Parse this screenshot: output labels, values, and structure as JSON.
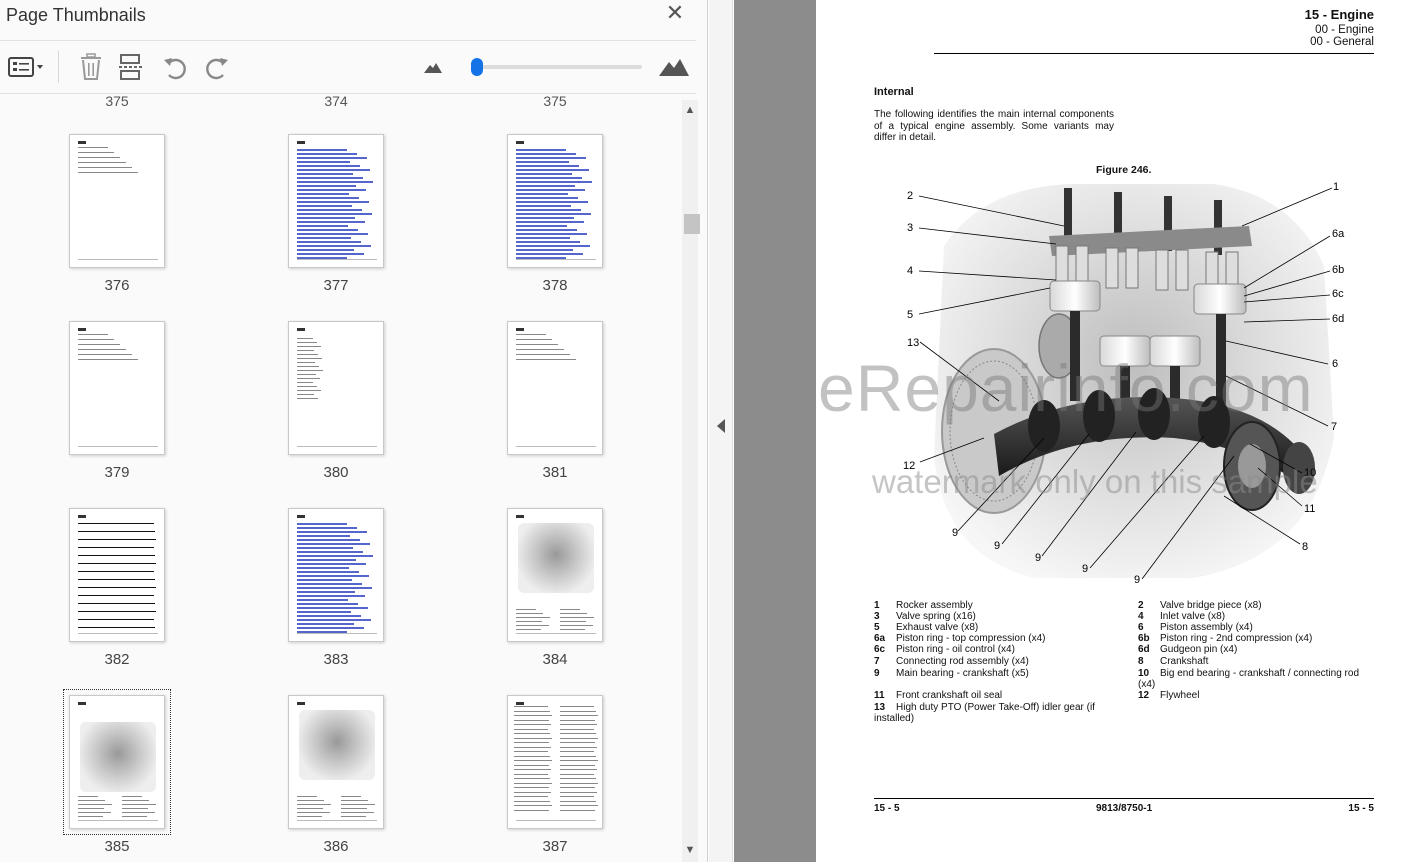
{
  "panel": {
    "title": "Page Thumbnails",
    "close_icon": "close-icon",
    "toolbar": {
      "options_icon": "thumbnail-options-icon",
      "delete_icon": "trash-icon",
      "insert_icon": "insert-pages-icon",
      "rotate_ccw_icon": "rotate-counterclockwise-icon",
      "rotate_cw_icon": "rotate-clockwise-icon",
      "zoom_out_icon": "small-mountain-icon",
      "zoom_in_icon": "large-mountain-icon",
      "zoom_fraction": 0.02
    },
    "cutoff_labels": [
      "375",
      "374",
      "375"
    ],
    "thumbnails": [
      {
        "page": "376"
      },
      {
        "page": "377"
      },
      {
        "page": "378"
      },
      {
        "page": "379"
      },
      {
        "page": "380"
      },
      {
        "page": "381"
      },
      {
        "page": "382"
      },
      {
        "page": "383"
      },
      {
        "page": "384"
      },
      {
        "page": "385",
        "selected": true
      },
      {
        "page": "386"
      },
      {
        "page": "387"
      }
    ]
  },
  "document": {
    "header": {
      "title": "15 - Engine",
      "sub1": "00 - Engine",
      "sub2": "00 - General"
    },
    "section_title": "Internal",
    "intro": "The following identifies the main internal components of a typical engine assembly. Some variants may differ in detail.",
    "figure_title": "Figure 246.",
    "callouts": [
      "1",
      "2",
      "3",
      "4",
      "5",
      "6a",
      "6b",
      "6c",
      "6d",
      "6",
      "7",
      "8",
      "9",
      "9",
      "9",
      "9",
      "9",
      "10",
      "11",
      "12",
      "13"
    ],
    "legend": [
      {
        "num": "1",
        "text": "Rocker assembly"
      },
      {
        "num": "2",
        "text": "Valve bridge piece (x8)"
      },
      {
        "num": "3",
        "text": "Valve spring (x16)"
      },
      {
        "num": "4",
        "text": "Inlet valve (x8)"
      },
      {
        "num": "5",
        "text": "Exhaust valve (x8)"
      },
      {
        "num": "6",
        "text": "Piston assembly (x4)"
      },
      {
        "num": "6a",
        "text": "Piston ring - top compression (x4)"
      },
      {
        "num": "6b",
        "text": "Piston ring - 2nd compression (x4)"
      },
      {
        "num": "6c",
        "text": "Piston ring - oil control (x4)"
      },
      {
        "num": "6d",
        "text": "Gudgeon pin (x4)"
      },
      {
        "num": "7",
        "text": "Connecting rod assembly (x4)"
      },
      {
        "num": "8",
        "text": "Crankshaft"
      },
      {
        "num": "9",
        "text": "Main bearing - crankshaft (x5)"
      },
      {
        "num": "10",
        "text": "Big end bearing - crankshaft / connecting rod (x4)"
      },
      {
        "num": "11",
        "text": "Front crankshaft oil seal"
      },
      {
        "num": "12",
        "text": "Flywheel"
      },
      {
        "num": "13",
        "text": "High duty PTO (Power Take-Off) idler gear (if installed)"
      }
    ],
    "footer": {
      "left": "15 - 5",
      "mid": "9813/8750-1",
      "right": "15 - 5"
    },
    "watermark_main": "eRepairinfo.com",
    "watermark_sub": "watermark only on this sample"
  }
}
